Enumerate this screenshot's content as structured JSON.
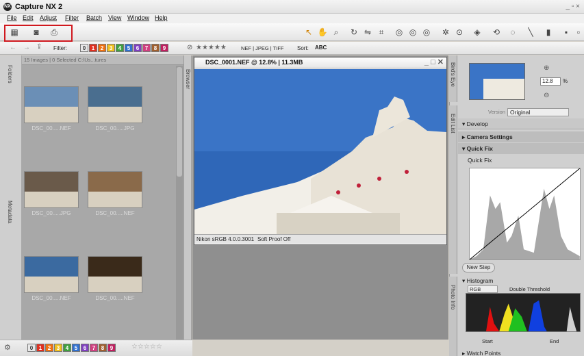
{
  "app": {
    "title": "Capture NX 2",
    "logo": "NX"
  },
  "menu": {
    "items": [
      "File",
      "Edit",
      "Adjust",
      "Filter",
      "Batch",
      "View",
      "Window",
      "Help"
    ]
  },
  "toolbar": {
    "left_icons": [
      "browser-layout-icon",
      "camera-icon",
      "print-icon"
    ],
    "right_icons": [
      "direct-select-icon",
      "hand-icon",
      "zoom-icon",
      "rotate-icon",
      "straighten-icon",
      "crop-icon",
      "red-eye-icon",
      "black-point-icon",
      "white-point-icon",
      "auto-retouch-icon",
      "color-control-point-icon",
      "selection-brush-icon",
      "lasso-icon",
      "marquee-icon",
      "gradient-icon",
      "fill-icon"
    ]
  },
  "filterbar": {
    "label": "Filter:",
    "label_numbers": [
      "0",
      "1",
      "2",
      "3",
      "4",
      "5",
      "6",
      "7",
      "8",
      "9"
    ],
    "label_colors": [
      "#e8e8e8",
      "#e03020",
      "#f07010",
      "#f0c020",
      "#40a040",
      "#3070d0",
      "#8040c0",
      "#d04080",
      "#a06030",
      "#c02060"
    ],
    "stars": "★★★★★",
    "formats": "NEF | JPEG | TIFF",
    "sort_label": "Sort:",
    "sort_value": "ABC"
  },
  "browser": {
    "status": "15 Images | 0 Selected  C:\\Us...tures",
    "tab_label": "Browser",
    "thumbs": [
      {
        "caption": "DSC_00.....NEF",
        "color": "#6b8fb6"
      },
      {
        "caption": "DSC_00.....JPG",
        "color": "#4a6e8f"
      },
      {
        "caption": "DSC_00.....JPG",
        "color": "#6a5a4a"
      },
      {
        "caption": "DSC_00.....NEF",
        "color": "#8a6a4a"
      },
      {
        "caption": "DSC_00.....NEF",
        "color": "#3b6aa0"
      },
      {
        "caption": "DSC_00.....NEF",
        "color": "#3a2a1a"
      }
    ]
  },
  "left_tabs": {
    "folders": "Folders",
    "metadata": "Metadata"
  },
  "image_window": {
    "title": "DSC_0001.NEF @ 12.8% | 11.3MB",
    "profile": "Nikon sRGB 4.0.0.3001",
    "proof": "Soft Proof Off"
  },
  "birds_eye": {
    "tab": "Bird's Eye",
    "zoom_value": "12.8",
    "zoom_unit": "%"
  },
  "edit_list": {
    "tab": "Edit List",
    "version_label": "Version",
    "version_value": "Original",
    "develop": "Develop",
    "camera_settings": "Camera Settings",
    "quick_fix": "Quick Fix",
    "quick_fix_sub": "Quick Fix",
    "new_step": "New Step"
  },
  "photo_info": {
    "tab": "Photo Info",
    "histogram": "Histogram",
    "channel": "RGB",
    "double_threshold": "Double Threshold",
    "start": "Start",
    "end": "End",
    "watch_points": "Watch Points"
  },
  "bottombar": {
    "label_numbers": [
      "0",
      "1",
      "2",
      "3",
      "4",
      "5",
      "6",
      "7",
      "8",
      "9"
    ],
    "stars": "☆☆☆☆☆"
  }
}
